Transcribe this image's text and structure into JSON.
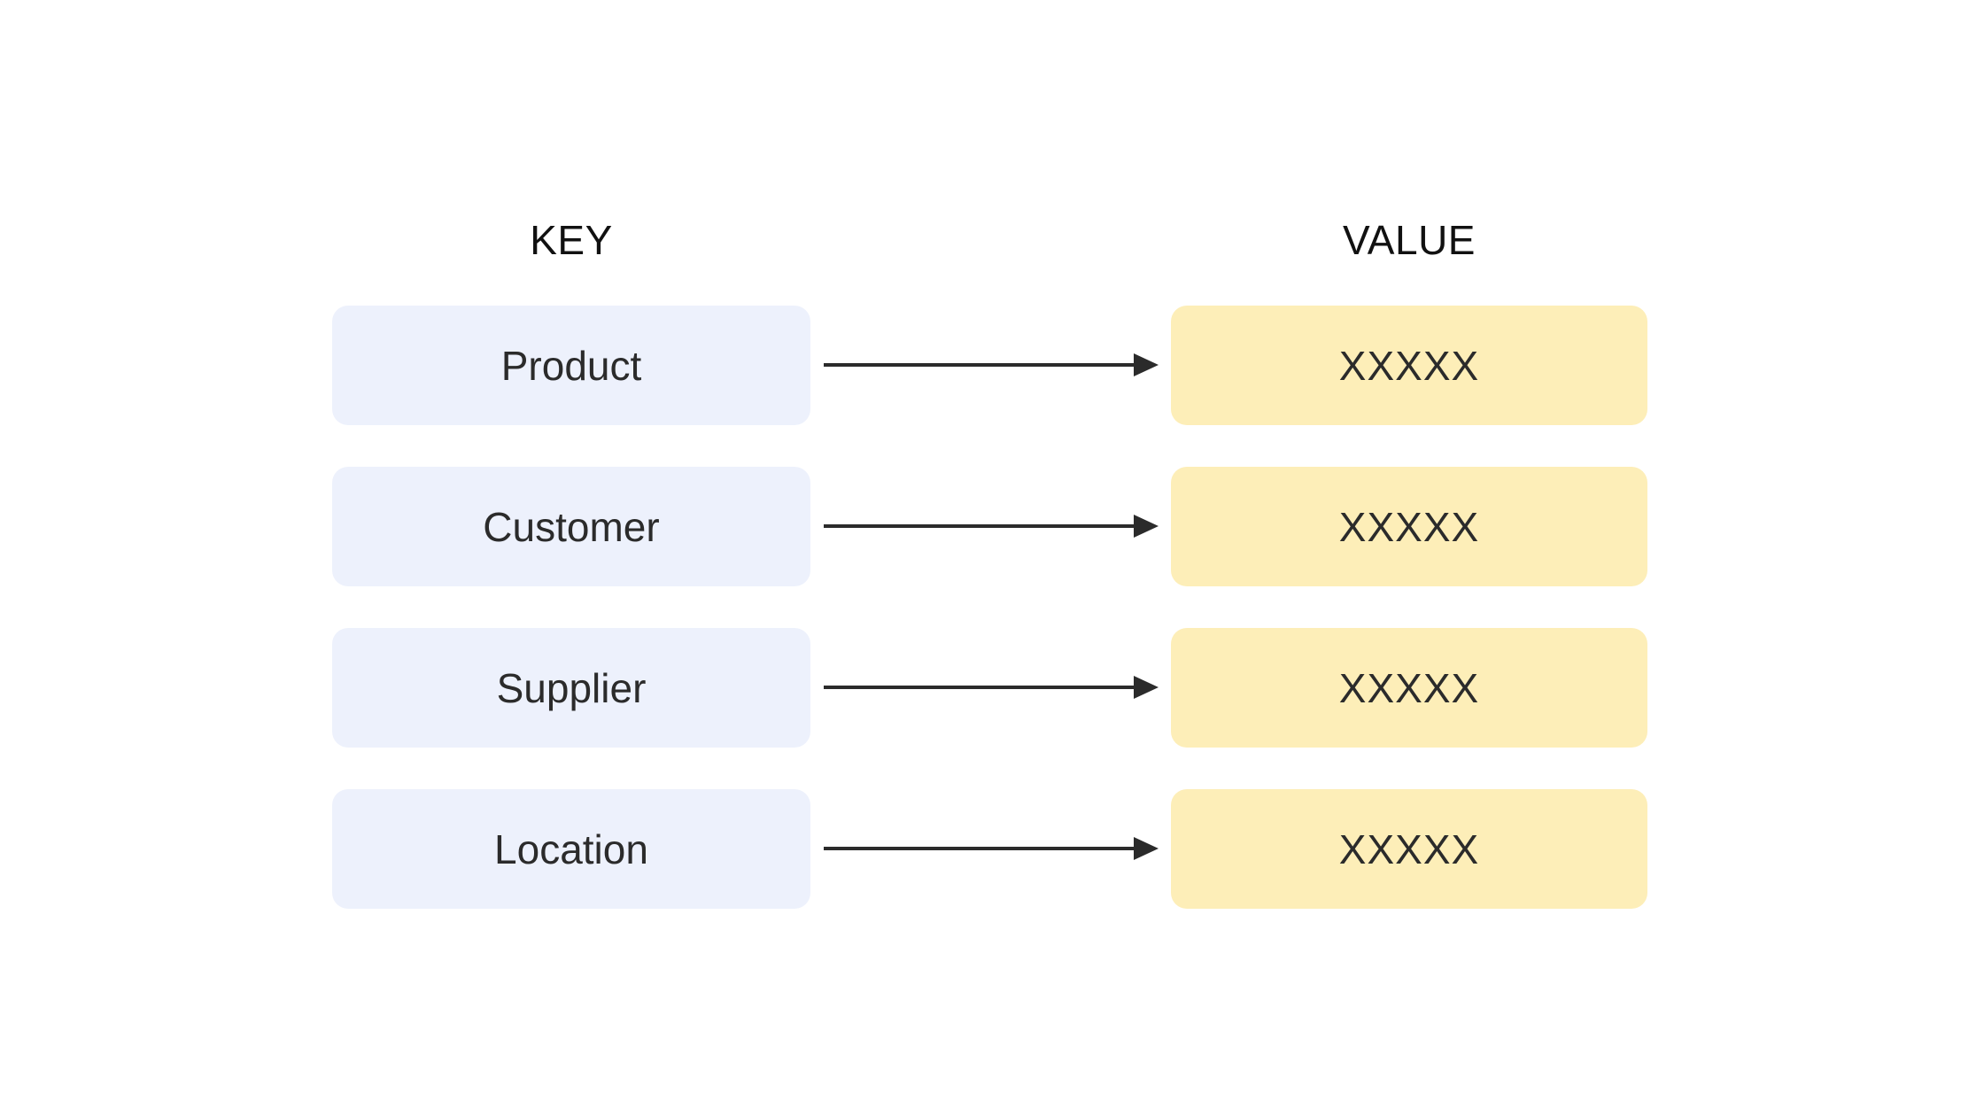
{
  "diagram": {
    "type": "key-value-mapping",
    "headers": {
      "key": "KEY",
      "value": "VALUE"
    },
    "rows": [
      {
        "key": "Product",
        "value": "XXXXX",
        "arrow": "arrow-right-icon"
      },
      {
        "key": "Customer",
        "value": "XXXXX",
        "arrow": "arrow-right-icon"
      },
      {
        "key": "Supplier",
        "value": "XXXXX",
        "arrow": "arrow-right-icon"
      },
      {
        "key": "Location",
        "value": "XXXXX",
        "arrow": "arrow-right-icon"
      }
    ],
    "colors": {
      "background": "#ffffff",
      "key_box_fill": "#edf1fc",
      "value_box_fill": "#fdeeb8",
      "text": "#2b2b2b",
      "header_text": "#111111",
      "arrow": "#2b2b2b"
    }
  }
}
